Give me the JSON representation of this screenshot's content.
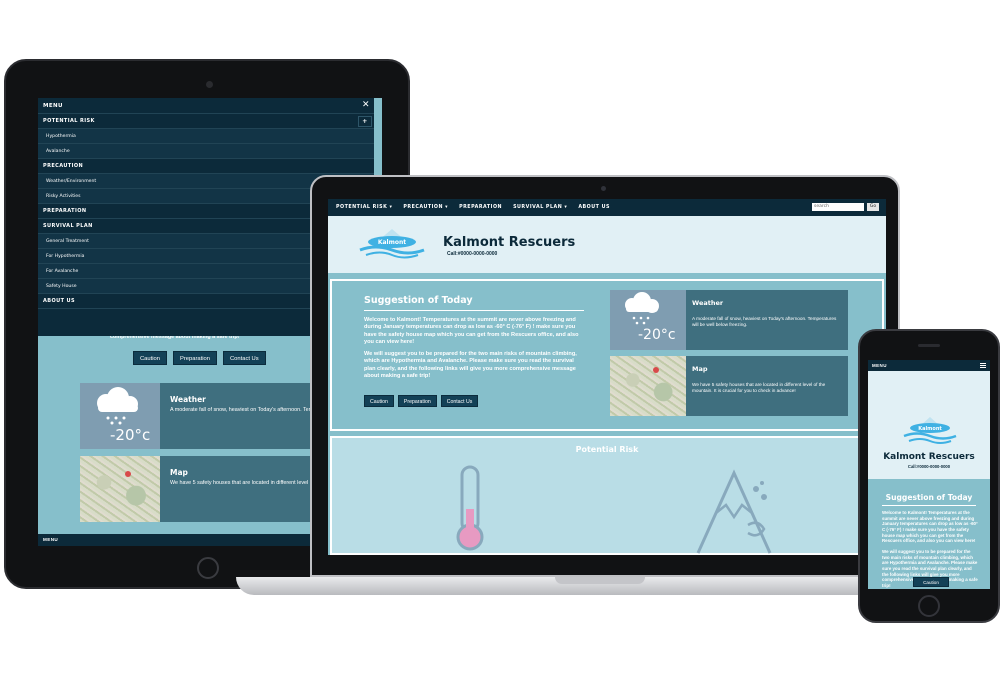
{
  "site": {
    "title": "Kalmont Rescuers",
    "call": "Call:#0000-0000-0000",
    "logo_text": "Kalmont"
  },
  "menu": {
    "label": "MENU",
    "close_icon": "close-icon",
    "sections": [
      {
        "label": "POTENTIAL RISK",
        "items": [
          "Hypothermia",
          "Avalanche"
        ]
      },
      {
        "label": "PRECAUTION",
        "items": [
          "Weather/Environment",
          "Risky Activities"
        ]
      },
      {
        "label": "PREPARATION",
        "items": []
      },
      {
        "label": "SURVIVAL PLAN",
        "items": [
          "General Treatment",
          "For Hypothermia",
          "For Avalanche",
          "Safety House"
        ]
      },
      {
        "label": "ABOUT US",
        "items": []
      }
    ]
  },
  "nav": {
    "items": [
      "POTENTIAL RISK",
      "PRECAUTION",
      "PREPARATION",
      "SURVIVAL PLAN",
      "ABOUT US"
    ],
    "search_placeholder": "search",
    "go_label": "Go"
  },
  "suggestion": {
    "title": "Suggestion of Today",
    "p1": "Welcome to Kalmont! Temperatures at the summit are never above freezing and during January temperatures can drop as low as -60° C (-76° F) ! make sure you have the safety house map which you can get from the Rescuers office, and also you can view here!",
    "p2": "We will suggest you to be prepared for the two main risks of mountain climbing, which are Hypothermia and Avalanche. Please make sure you read the survival plan clearly, and the following links will give you more comprehensive message about making a safe trip!",
    "buttons": [
      "Caution",
      "Preparation",
      "Contact Us"
    ]
  },
  "weather_card": {
    "title": "Weather",
    "text": "A moderate fall of snow, heaviest on Today's afternoon. Temperatures will be well below freezing.",
    "temp": "-20°c"
  },
  "map_card": {
    "title": "Map",
    "text": "We have 5 safety houses that are located in different level of the mountain. It is crucial for you to check in advance!"
  },
  "potential_risk": {
    "title": "Potential Risk"
  },
  "tablet": {
    "partial_text": "comprehensive message about making a safe trip!",
    "footer_menu": "MENU"
  },
  "colors": {
    "navy": "#0c2a3a",
    "teal": "#86bfcb",
    "card": "#3f6f7f",
    "header_bg": "#e1f0f5"
  }
}
